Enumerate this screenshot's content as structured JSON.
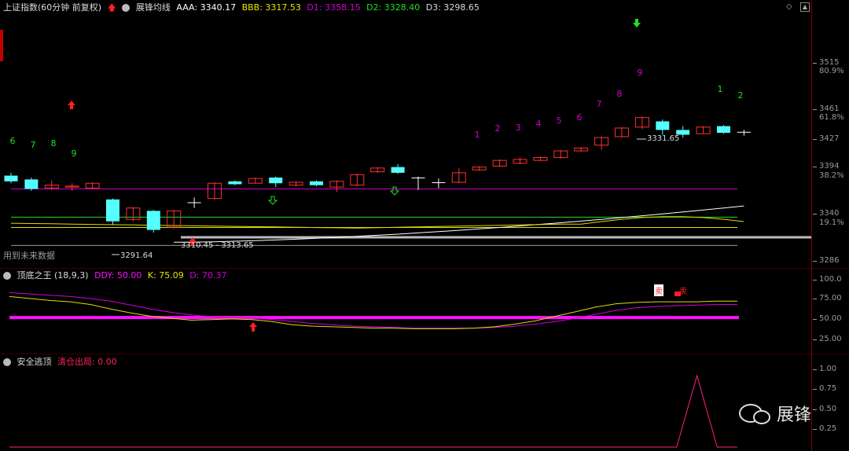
{
  "colors": {
    "bull": "#ff3030",
    "bear": "#54ffff",
    "magenta": "#d200d2",
    "green": "#22dd22",
    "yellow": "#dddd00",
    "white": "#ffffff",
    "gray": "#9a9a9a",
    "ddy": "#ff10ff"
  },
  "main_header": {
    "title": "上证指数(60分钟 前复权)",
    "indicator": "展锋均线",
    "aaa": "AAA: 3340.17",
    "bbb": "BBB: 3317.53",
    "d1": "D1: 3358.15",
    "d2": "D2: 3328.40",
    "d3": "D3: 3298.65"
  },
  "main_axis": {
    "labels": [
      "3515",
      "80.9%",
      "3461",
      "61.8%",
      "3427",
      "3394",
      "38.2%",
      "3340",
      "19.1%",
      "3286"
    ]
  },
  "main_annotations": {
    "low_label": "3291.64",
    "high_label": "3331.65",
    "range_label": "3310.45 - 3313.65",
    "future_note": "用到未来数据"
  },
  "sequence_numbers": {
    "left": [
      "6",
      "7",
      "8",
      "9"
    ],
    "right": [
      "1",
      "2",
      "3",
      "4",
      "5",
      "6",
      "7",
      "8",
      "9"
    ],
    "far": [
      "1",
      "2"
    ]
  },
  "sub1_header": {
    "title": "顶底之王",
    "params": "(18,9,3)",
    "ddy": "DDY: 50.00",
    "k": "K: 75.09",
    "d": "D: 70.37"
  },
  "sub1_axis": {
    "labels": [
      "100.0",
      "75.00",
      "50.00",
      "25.00"
    ]
  },
  "sub1_signals": {
    "sell1": "卖",
    "sell2": "卖"
  },
  "sub2_header": {
    "title": "安全逃顶",
    "label": "清仓出局: 0.00"
  },
  "sub2_axis": {
    "labels": [
      "1.00",
      "0.75",
      "0.50",
      "0.25"
    ]
  },
  "watermark": {
    "text": "展锋"
  },
  "chart_data": {
    "type": "candlestick",
    "candles": [
      {
        "o": 3372,
        "c": 3366,
        "h": 3375,
        "l": 3364
      },
      {
        "o": 3368,
        "c": 3358,
        "h": 3370,
        "l": 3356
      },
      {
        "o": 3359,
        "c": 3362,
        "h": 3367,
        "l": 3357
      },
      {
        "o": 3360,
        "c": 3361,
        "h": 3364,
        "l": 3356
      },
      {
        "o": 3359,
        "c": 3364,
        "h": 3365,
        "l": 3358
      },
      {
        "o": 3347,
        "c": 3324,
        "h": 3348,
        "l": 3320
      },
      {
        "o": 3326,
        "c": 3338,
        "h": 3339,
        "l": 3324
      },
      {
        "o": 3335,
        "c": 3315,
        "h": 3336,
        "l": 3312
      },
      {
        "o": 3318,
        "c": 3335,
        "h": 3336,
        "l": 3316
      },
      {
        "o": 3344,
        "c": 3344,
        "h": 3349,
        "l": 3338
      },
      {
        "o": 3348,
        "c": 3364,
        "h": 3365,
        "l": 3347
      },
      {
        "o": 3366,
        "c": 3363,
        "h": 3367,
        "l": 3362
      },
      {
        "o": 3364,
        "c": 3369,
        "h": 3370,
        "l": 3364
      },
      {
        "o": 3370,
        "c": 3364,
        "h": 3371,
        "l": 3360
      },
      {
        "o": 3362,
        "c": 3365,
        "h": 3366,
        "l": 3361
      },
      {
        "o": 3366,
        "c": 3362,
        "h": 3367,
        "l": 3361
      },
      {
        "o": 3360,
        "c": 3366,
        "h": 3367,
        "l": 3355
      },
      {
        "o": 3362,
        "c": 3373,
        "h": 3374,
        "l": 3361
      },
      {
        "o": 3376,
        "c": 3380,
        "h": 3381,
        "l": 3375
      },
      {
        "o": 3381,
        "c": 3375,
        "h": 3384,
        "l": 3374
      },
      {
        "o": 3370,
        "c": 3370,
        "h": 3371,
        "l": 3357
      },
      {
        "o": 3365,
        "c": 3365,
        "h": 3369,
        "l": 3359
      },
      {
        "o": 3365,
        "c": 3375,
        "h": 3380,
        "l": 3364
      },
      {
        "o": 3378,
        "c": 3381,
        "h": 3382,
        "l": 3377
      },
      {
        "o": 3382,
        "c": 3388,
        "h": 3389,
        "l": 3381
      },
      {
        "o": 3385,
        "c": 3389,
        "h": 3391,
        "l": 3384
      },
      {
        "o": 3388,
        "c": 3391,
        "h": 3392,
        "l": 3387
      },
      {
        "o": 3391,
        "c": 3398,
        "h": 3399,
        "l": 3390
      },
      {
        "o": 3398,
        "c": 3401,
        "h": 3402,
        "l": 3397
      },
      {
        "o": 3404,
        "c": 3412,
        "h": 3413,
        "l": 3399
      },
      {
        "o": 3413,
        "c": 3422,
        "h": 3423,
        "l": 3412
      },
      {
        "o": 3423,
        "c": 3433,
        "h": 3434,
        "l": 3421
      },
      {
        "o": 3429,
        "c": 3420,
        "h": 3431,
        "l": 3415
      },
      {
        "o": 3420,
        "c": 3415,
        "h": 3424,
        "l": 3412
      },
      {
        "o": 3416,
        "c": 3423,
        "h": 3424,
        "l": 3416
      },
      {
        "o": 3424,
        "c": 3417,
        "h": 3425,
        "l": 3416
      },
      {
        "o": 3418,
        "c": 3418,
        "h": 3420,
        "l": 3414
      }
    ],
    "lines": {
      "d1": 3358.15,
      "d2": 3328.4,
      "d3": 3298.65,
      "aaa": 3340.17,
      "bbb": 3317.53,
      "bbb_start": 3322
    },
    "ylim": [
      3280,
      3540
    ],
    "kdj": {
      "ylim": [
        0,
        110
      ],
      "ddy": 50,
      "k": [
        82,
        79,
        76,
        74,
        70,
        63,
        57,
        52,
        49,
        46,
        47,
        48,
        47,
        44,
        39,
        37,
        36,
        35,
        34,
        34,
        33,
        33,
        33,
        34,
        36,
        40,
        45,
        52,
        59,
        66,
        71,
        73,
        74,
        74,
        74,
        75,
        75
      ],
      "d": [
        88,
        86,
        84,
        82,
        79,
        75,
        69,
        63,
        58,
        54,
        51,
        50,
        49,
        47,
        44,
        41,
        39,
        37,
        36,
        35,
        34,
        34,
        34,
        34,
        35,
        37,
        40,
        44,
        49,
        55,
        61,
        65,
        67,
        68,
        69,
        70,
        70
      ]
    },
    "escape": {
      "ylim": [
        0,
        1.1
      ],
      "peak_index": 34,
      "peak_value": 1.0
    }
  }
}
